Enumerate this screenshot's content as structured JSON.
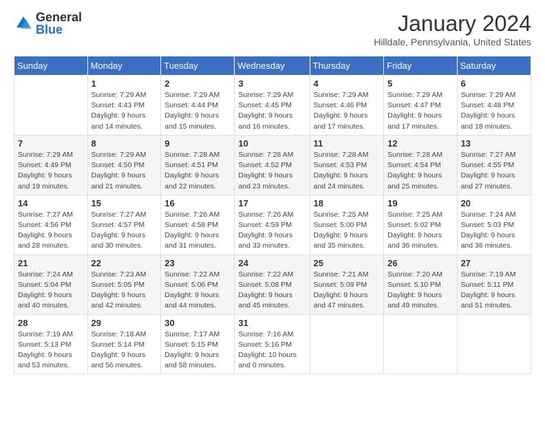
{
  "logo": {
    "general": "General",
    "blue": "Blue"
  },
  "title": "January 2024",
  "location": "Hilldale, Pennsylvania, United States",
  "days_of_week": [
    "Sunday",
    "Monday",
    "Tuesday",
    "Wednesday",
    "Thursday",
    "Friday",
    "Saturday"
  ],
  "weeks": [
    [
      {
        "day": "",
        "info": ""
      },
      {
        "day": "1",
        "info": "Sunrise: 7:29 AM\nSunset: 4:43 PM\nDaylight: 9 hours\nand 14 minutes."
      },
      {
        "day": "2",
        "info": "Sunrise: 7:29 AM\nSunset: 4:44 PM\nDaylight: 9 hours\nand 15 minutes."
      },
      {
        "day": "3",
        "info": "Sunrise: 7:29 AM\nSunset: 4:45 PM\nDaylight: 9 hours\nand 16 minutes."
      },
      {
        "day": "4",
        "info": "Sunrise: 7:29 AM\nSunset: 4:46 PM\nDaylight: 9 hours\nand 17 minutes."
      },
      {
        "day": "5",
        "info": "Sunrise: 7:29 AM\nSunset: 4:47 PM\nDaylight: 9 hours\nand 17 minutes."
      },
      {
        "day": "6",
        "info": "Sunrise: 7:29 AM\nSunset: 4:48 PM\nDaylight: 9 hours\nand 18 minutes."
      }
    ],
    [
      {
        "day": "7",
        "info": "Sunrise: 7:29 AM\nSunset: 4:49 PM\nDaylight: 9 hours\nand 19 minutes."
      },
      {
        "day": "8",
        "info": "Sunrise: 7:29 AM\nSunset: 4:50 PM\nDaylight: 9 hours\nand 21 minutes."
      },
      {
        "day": "9",
        "info": "Sunrise: 7:28 AM\nSunset: 4:51 PM\nDaylight: 9 hours\nand 22 minutes."
      },
      {
        "day": "10",
        "info": "Sunrise: 7:28 AM\nSunset: 4:52 PM\nDaylight: 9 hours\nand 23 minutes."
      },
      {
        "day": "11",
        "info": "Sunrise: 7:28 AM\nSunset: 4:53 PM\nDaylight: 9 hours\nand 24 minutes."
      },
      {
        "day": "12",
        "info": "Sunrise: 7:28 AM\nSunset: 4:54 PM\nDaylight: 9 hours\nand 25 minutes."
      },
      {
        "day": "13",
        "info": "Sunrise: 7:27 AM\nSunset: 4:55 PM\nDaylight: 9 hours\nand 27 minutes."
      }
    ],
    [
      {
        "day": "14",
        "info": "Sunrise: 7:27 AM\nSunset: 4:56 PM\nDaylight: 9 hours\nand 28 minutes."
      },
      {
        "day": "15",
        "info": "Sunrise: 7:27 AM\nSunset: 4:57 PM\nDaylight: 9 hours\nand 30 minutes."
      },
      {
        "day": "16",
        "info": "Sunrise: 7:26 AM\nSunset: 4:58 PM\nDaylight: 9 hours\nand 31 minutes."
      },
      {
        "day": "17",
        "info": "Sunrise: 7:26 AM\nSunset: 4:59 PM\nDaylight: 9 hours\nand 33 minutes."
      },
      {
        "day": "18",
        "info": "Sunrise: 7:25 AM\nSunset: 5:00 PM\nDaylight: 9 hours\nand 35 minutes."
      },
      {
        "day": "19",
        "info": "Sunrise: 7:25 AM\nSunset: 5:02 PM\nDaylight: 9 hours\nand 36 minutes."
      },
      {
        "day": "20",
        "info": "Sunrise: 7:24 AM\nSunset: 5:03 PM\nDaylight: 9 hours\nand 38 minutes."
      }
    ],
    [
      {
        "day": "21",
        "info": "Sunrise: 7:24 AM\nSunset: 5:04 PM\nDaylight: 9 hours\nand 40 minutes."
      },
      {
        "day": "22",
        "info": "Sunrise: 7:23 AM\nSunset: 5:05 PM\nDaylight: 9 hours\nand 42 minutes."
      },
      {
        "day": "23",
        "info": "Sunrise: 7:22 AM\nSunset: 5:06 PM\nDaylight: 9 hours\nand 44 minutes."
      },
      {
        "day": "24",
        "info": "Sunrise: 7:22 AM\nSunset: 5:08 PM\nDaylight: 9 hours\nand 45 minutes."
      },
      {
        "day": "25",
        "info": "Sunrise: 7:21 AM\nSunset: 5:09 PM\nDaylight: 9 hours\nand 47 minutes."
      },
      {
        "day": "26",
        "info": "Sunrise: 7:20 AM\nSunset: 5:10 PM\nDaylight: 9 hours\nand 49 minutes."
      },
      {
        "day": "27",
        "info": "Sunrise: 7:19 AM\nSunset: 5:11 PM\nDaylight: 9 hours\nand 51 minutes."
      }
    ],
    [
      {
        "day": "28",
        "info": "Sunrise: 7:19 AM\nSunset: 5:13 PM\nDaylight: 9 hours\nand 53 minutes."
      },
      {
        "day": "29",
        "info": "Sunrise: 7:18 AM\nSunset: 5:14 PM\nDaylight: 9 hours\nand 56 minutes."
      },
      {
        "day": "30",
        "info": "Sunrise: 7:17 AM\nSunset: 5:15 PM\nDaylight: 9 hours\nand 58 minutes."
      },
      {
        "day": "31",
        "info": "Sunrise: 7:16 AM\nSunset: 5:16 PM\nDaylight: 10 hours\nand 0 minutes."
      },
      {
        "day": "",
        "info": ""
      },
      {
        "day": "",
        "info": ""
      },
      {
        "day": "",
        "info": ""
      }
    ]
  ]
}
